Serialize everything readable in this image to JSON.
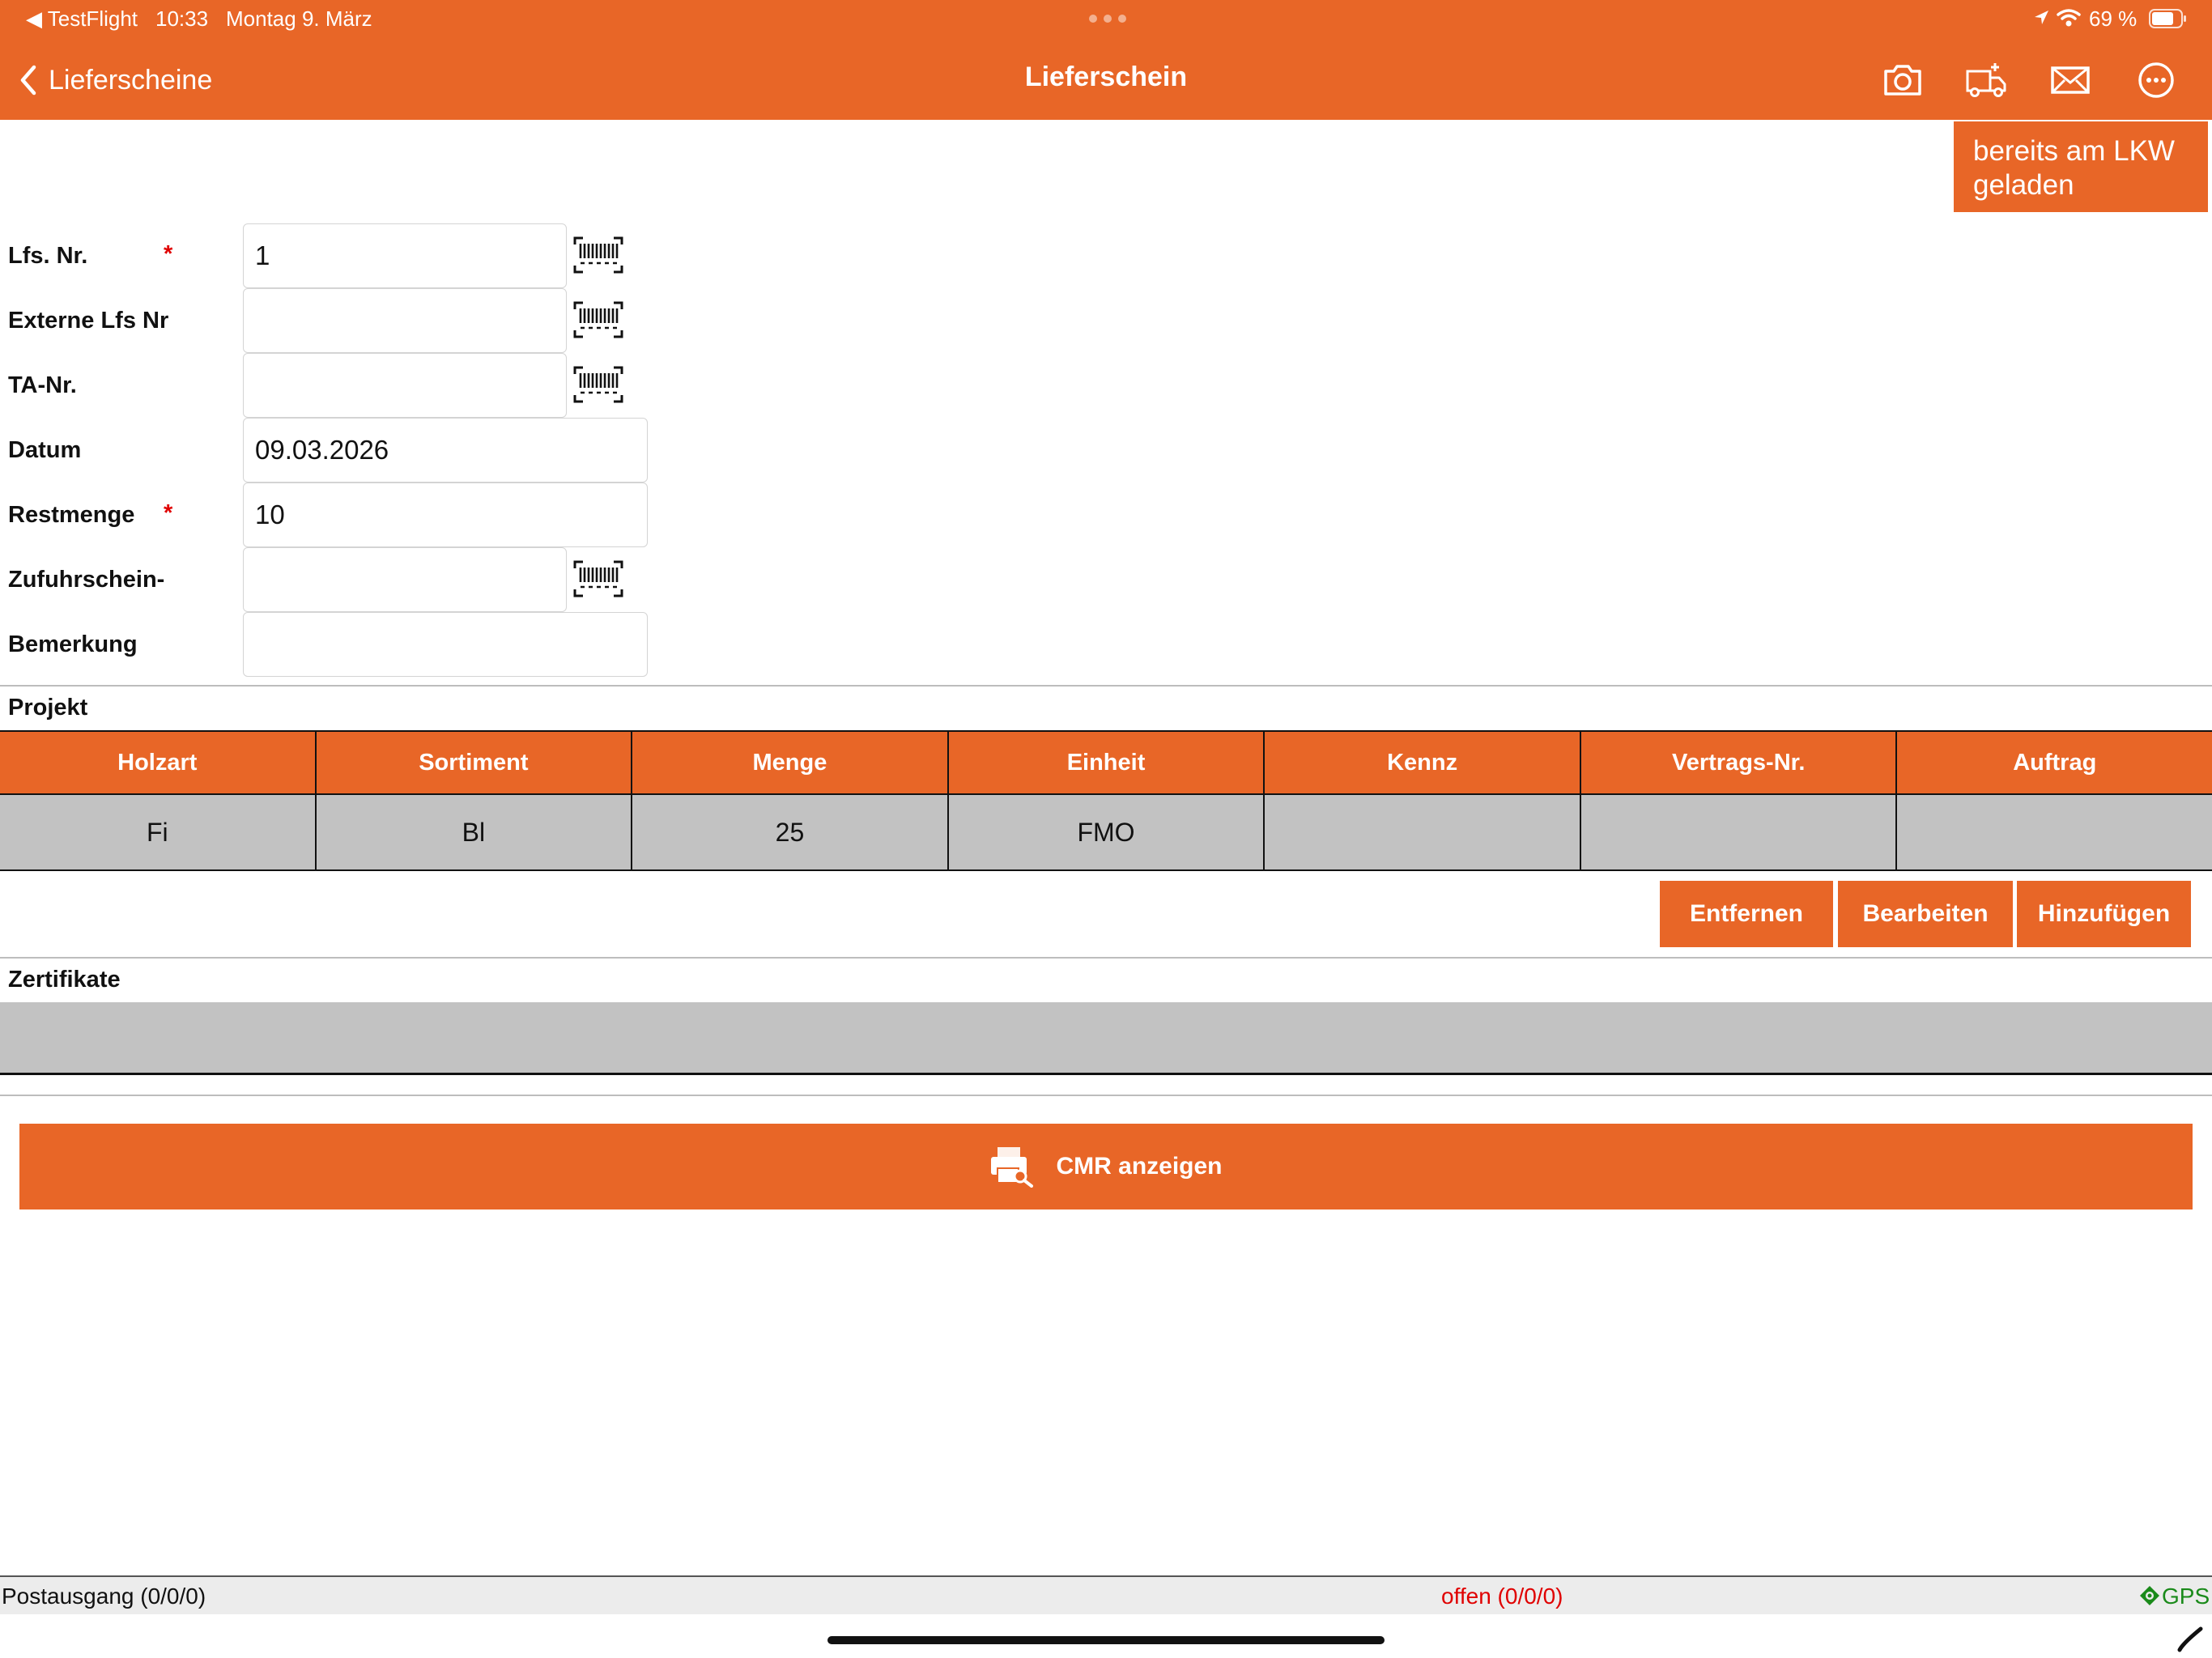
{
  "status_bar": {
    "back_app": "◀ TestFlight",
    "time": "10:33",
    "date": "Montag 9. März",
    "battery": "69 %"
  },
  "nav": {
    "back_label": "Lieferscheine",
    "title": "Lieferschein",
    "icons": [
      "camera-icon",
      "truck-add-icon",
      "mail-icon",
      "more-icon"
    ]
  },
  "loaded_button": "bereits am LKW geladen",
  "form": {
    "lfs_nr": {
      "label": "Lfs. Nr.",
      "required": "*",
      "value": "1"
    },
    "externe_lfs_nr": {
      "label": "Externe Lfs Nr",
      "value": ""
    },
    "ta_nr": {
      "label": "TA-Nr.",
      "value": ""
    },
    "datum": {
      "label": "Datum",
      "value": "09.03.2026"
    },
    "restmenge": {
      "label": "Restmenge",
      "required": "*",
      "value": "10"
    },
    "zufuhrschein": {
      "label": "Zufuhrschein-",
      "value": ""
    },
    "bemerkung": {
      "label": "Bemerkung",
      "value": ""
    }
  },
  "projekt": {
    "label": "Projekt",
    "columns": [
      "Holzart",
      "Sortiment",
      "Menge",
      "Einheit",
      "Kennz",
      "Vertrags-Nr.",
      "Auftrag"
    ],
    "rows": [
      [
        "Fi",
        "Bl",
        "25",
        "FMO",
        "",
        "",
        ""
      ]
    ],
    "buttons": {
      "remove": "Entfernen",
      "edit": "Bearbeiten",
      "add": "Hinzufügen"
    }
  },
  "zertifikate": {
    "label": "Zertifikate"
  },
  "cmr_button": "CMR anzeigen",
  "footer": {
    "outbox": "Postausgang (0/0/0)",
    "open": "offen (0/0/0)",
    "gps": "GPS"
  },
  "colors": {
    "accent": "#E86627",
    "row_gray": "#c2c2c2",
    "required": "#e00000",
    "gps": "#1a8a1a"
  }
}
